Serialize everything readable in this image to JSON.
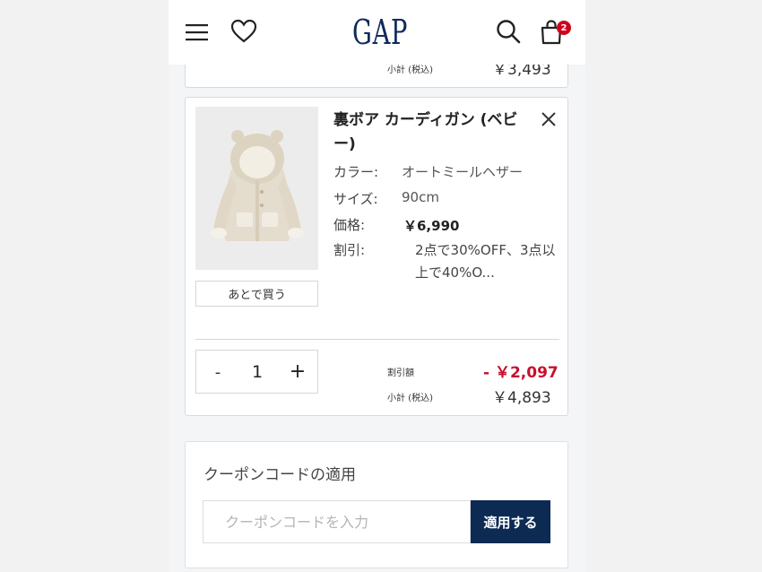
{
  "header": {
    "logo_text": "GAP",
    "cart_count": "2"
  },
  "previous_item": {
    "subtotal_label": "小計 (税込)",
    "subtotal_value": "￥3,493"
  },
  "cart_item": {
    "name": "裏ボア カーディガン (ベビー)",
    "save_later_label": "あとで買う",
    "color_label": "カラー:",
    "color_value": "オートミールヘザー",
    "size_label": "サイズ:",
    "size_value": "90cm",
    "price_label": "価格:",
    "price_value": "￥6,990",
    "discount_label": "割引:",
    "discount_value": "2点で30%OFF、3点以上で40%O...",
    "quantity": "1",
    "qty_minus": "-",
    "qty_plus": "+",
    "discount_amount_label": "割引額",
    "discount_amount": "- ￥2,097",
    "subtotal_label": "小計 (税込)",
    "subtotal_value": "￥4,893"
  },
  "coupon": {
    "title": "クーポンコードの適用",
    "placeholder": "クーポンコードを入力",
    "apply_label": "適用する"
  },
  "icons": {
    "menu": "menu-icon",
    "favorites": "heart-icon",
    "search": "search-icon",
    "cart": "bag-icon",
    "remove": "close-icon"
  },
  "colors": {
    "brand_navy": "#0d2a52",
    "discount_red": "#c8102e",
    "badge_red": "#d0021b"
  }
}
